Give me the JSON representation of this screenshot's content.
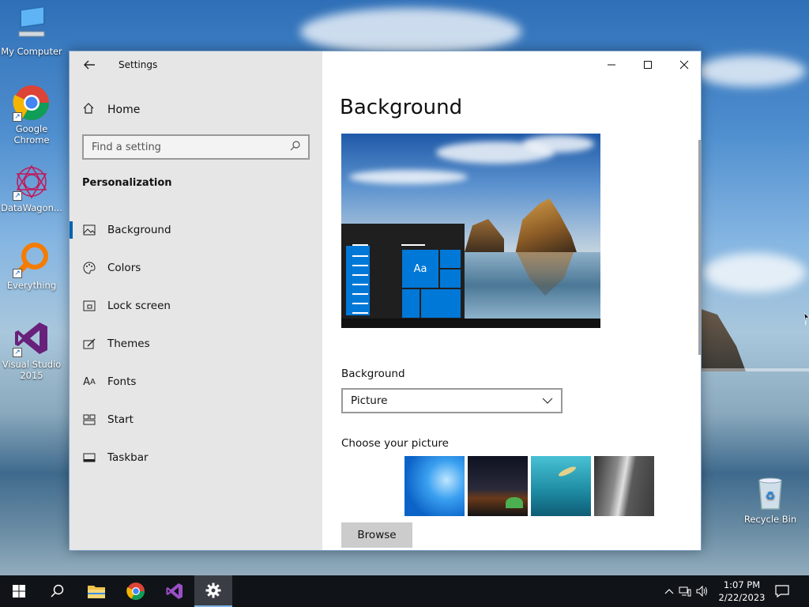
{
  "desktop": {
    "icons": [
      {
        "label": "My Computer",
        "icon": "computer-icon"
      },
      {
        "label": "Google Chrome",
        "icon": "chrome-icon"
      },
      {
        "label": "DataWagon...",
        "icon": "datawagon-icon"
      },
      {
        "label": "Everything",
        "icon": "everything-search-icon"
      },
      {
        "label": "Visual Studio 2015",
        "icon": "visual-studio-icon"
      },
      {
        "label": "Recycle Bin",
        "icon": "recycle-bin-icon"
      }
    ]
  },
  "window": {
    "title": "Settings",
    "controls": {
      "minimize": "—",
      "maximize": "☐",
      "close": "✕"
    }
  },
  "nav": {
    "home_label": "Home",
    "search_placeholder": "Find a setting",
    "section_title": "Personalization",
    "items": [
      {
        "label": "Background",
        "icon": "picture-icon",
        "active": true
      },
      {
        "label": "Colors",
        "icon": "palette-icon"
      },
      {
        "label": "Lock screen",
        "icon": "lock-screen-icon"
      },
      {
        "label": "Themes",
        "icon": "themes-brush-icon"
      },
      {
        "label": "Fonts",
        "icon": "fonts-icon"
      },
      {
        "label": "Start",
        "icon": "start-layout-icon"
      },
      {
        "label": "Taskbar",
        "icon": "taskbar-icon"
      }
    ]
  },
  "content": {
    "page_title": "Background",
    "preview_tile_text": "Aa",
    "background_label": "Background",
    "background_value": "Picture",
    "choose_label": "Choose your picture",
    "browse_label": "Browse"
  },
  "taskbar": {
    "buttons": [
      "start-icon",
      "search-icon",
      "file-explorer-icon",
      "chrome-icon",
      "visual-studio-icon",
      "settings-gear-icon"
    ],
    "active": "settings-gear-icon",
    "clock_time": "1:07 PM",
    "clock_date": "2/22/2023"
  },
  "colors": {
    "accent": "#0063b1",
    "nav_bg": "#e6e6e6",
    "taskbar_bg": "#101418"
  }
}
